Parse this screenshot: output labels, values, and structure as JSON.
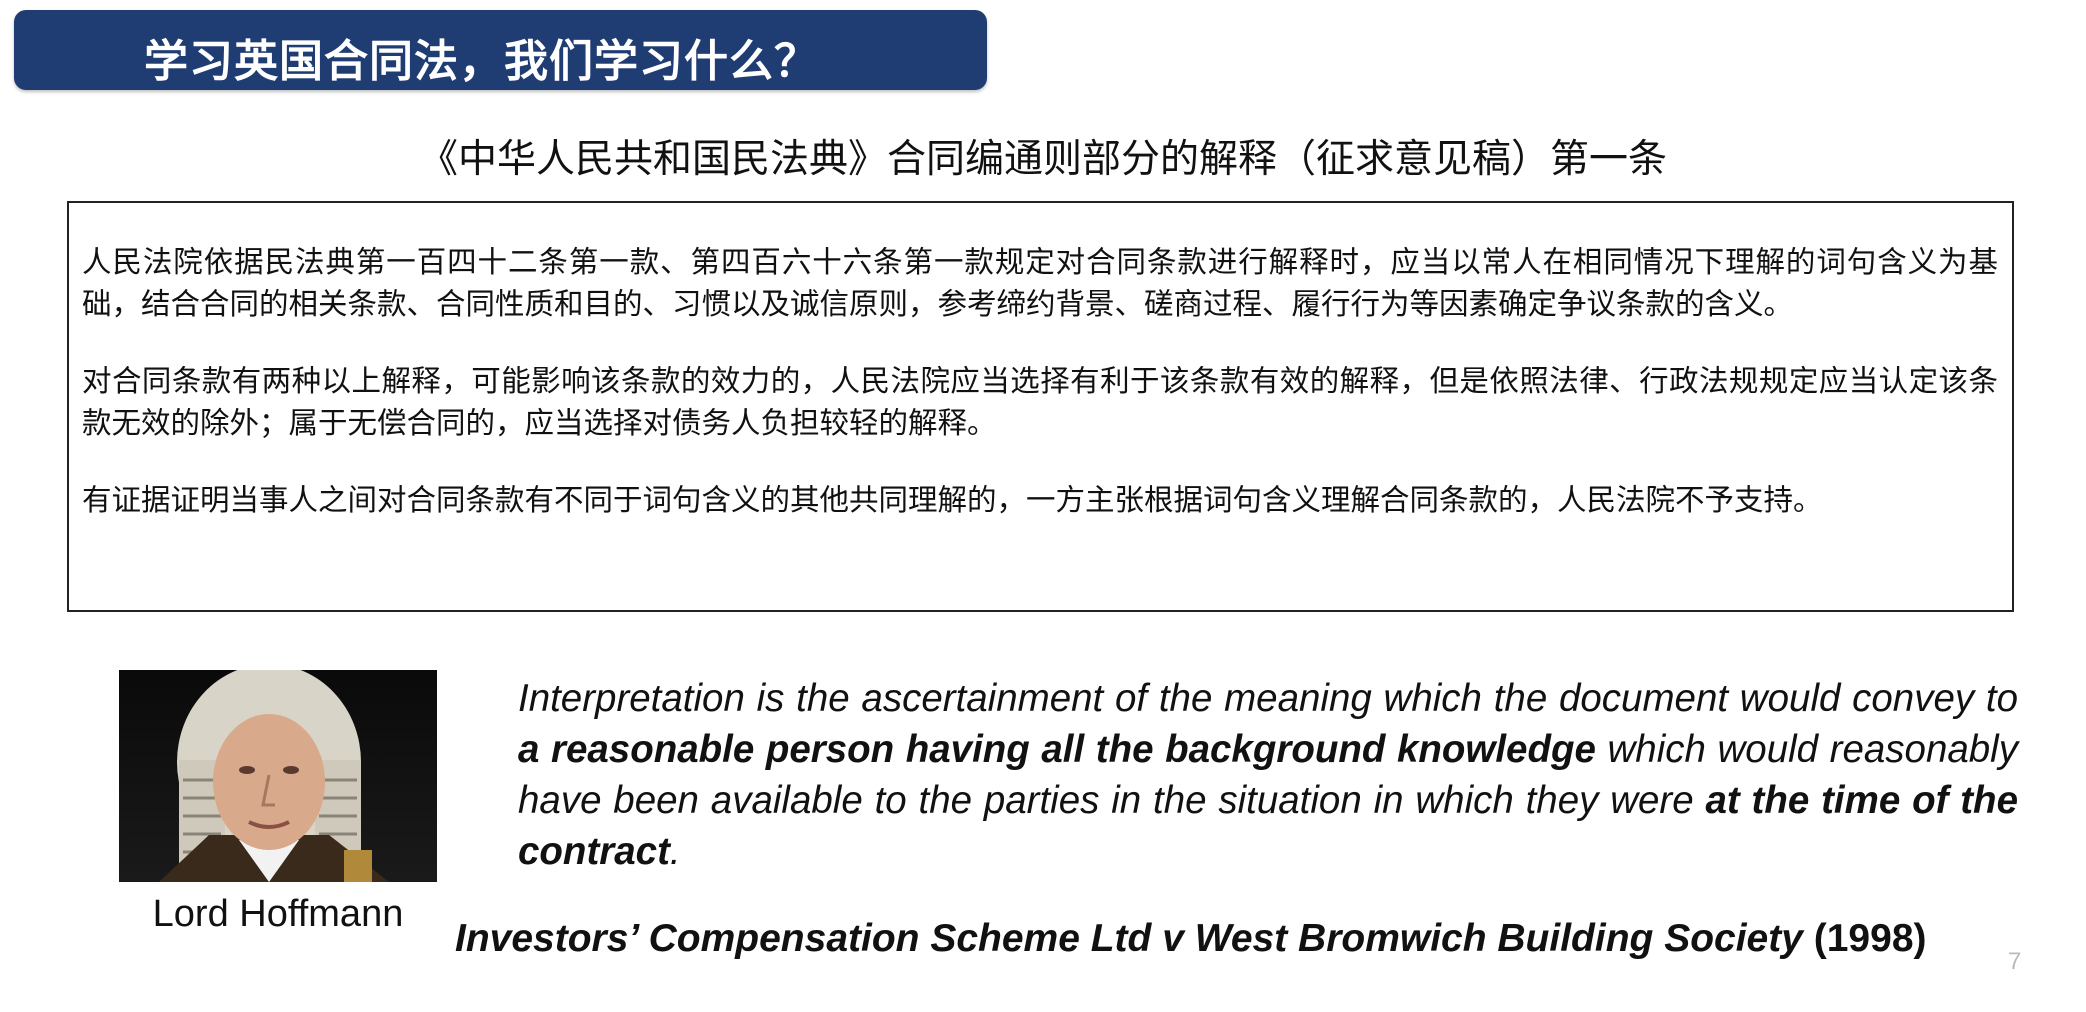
{
  "slide": {
    "title": "学习英国合同法，我们学习什么？",
    "subtitle": "《中华人民共和国民法典》合同编通则部分的解释（征求意见稿）第一条",
    "article_paragraphs": [
      "人民法院依据民法典第一百四十二条第一款、第四百六十六条第一款规定对合同条款进行解释时，应当以常人在相同情况下理解的词句含义为基础，结合合同的相关条款、合同性质和目的、习惯以及诚信原则，参考缔约背景、磋商过程、履行行为等因素确定争议条款的含义。",
      "对合同条款有两种以上解释，可能影响该条款的效力的，人民法院应当选择有利于该条款有效的解释，但是依照法律、行政法规规定应当认定该条款无效的除外；属于无偿合同的，应当选择对债务人负担较轻的解释。",
      "有证据证明当事人之间对合同条款有不同于词句含义的其他共同理解的，一方主张根据词句含义理解合同条款的，人民法院不予支持。"
    ],
    "portrait_caption": "Lord Hoffmann",
    "quote": {
      "part1": "Interpretation is the ascertainment of the meaning which the document would convey to ",
      "bold1": "a reasonable person  having all the background knowledge",
      "part2": " which would reasonably have been available to the parties in the situation in which they were ",
      "bold2": "at the time of the contract",
      "part3": "."
    },
    "citation": {
      "case_name": "Investors’ Compensation Scheme Ltd v West Bromwich Building Society",
      "year": " (1998)"
    },
    "page_number": "7"
  },
  "colors": {
    "banner": "#1f3d73",
    "banner_text": "#ffffff",
    "text": "#111111"
  }
}
